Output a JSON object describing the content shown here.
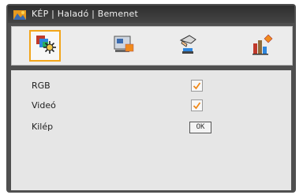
{
  "title": "KÉP | Haladó | Bemenet",
  "tabs": [
    {
      "icon": "image-settings-icon",
      "active": true
    },
    {
      "icon": "display-screen-icon",
      "active": false
    },
    {
      "icon": "setup-hand-icon",
      "active": false
    },
    {
      "icon": "options-chart-icon",
      "active": false
    }
  ],
  "items": [
    {
      "label": "RGB",
      "checked": true
    },
    {
      "label": "Videó",
      "checked": true
    },
    {
      "label": "Kilép"
    }
  ],
  "ok_label": "OK",
  "colors": {
    "frame": "#4f4f4f",
    "panel": "#e6e6e6",
    "accent": "#f2a51a"
  }
}
